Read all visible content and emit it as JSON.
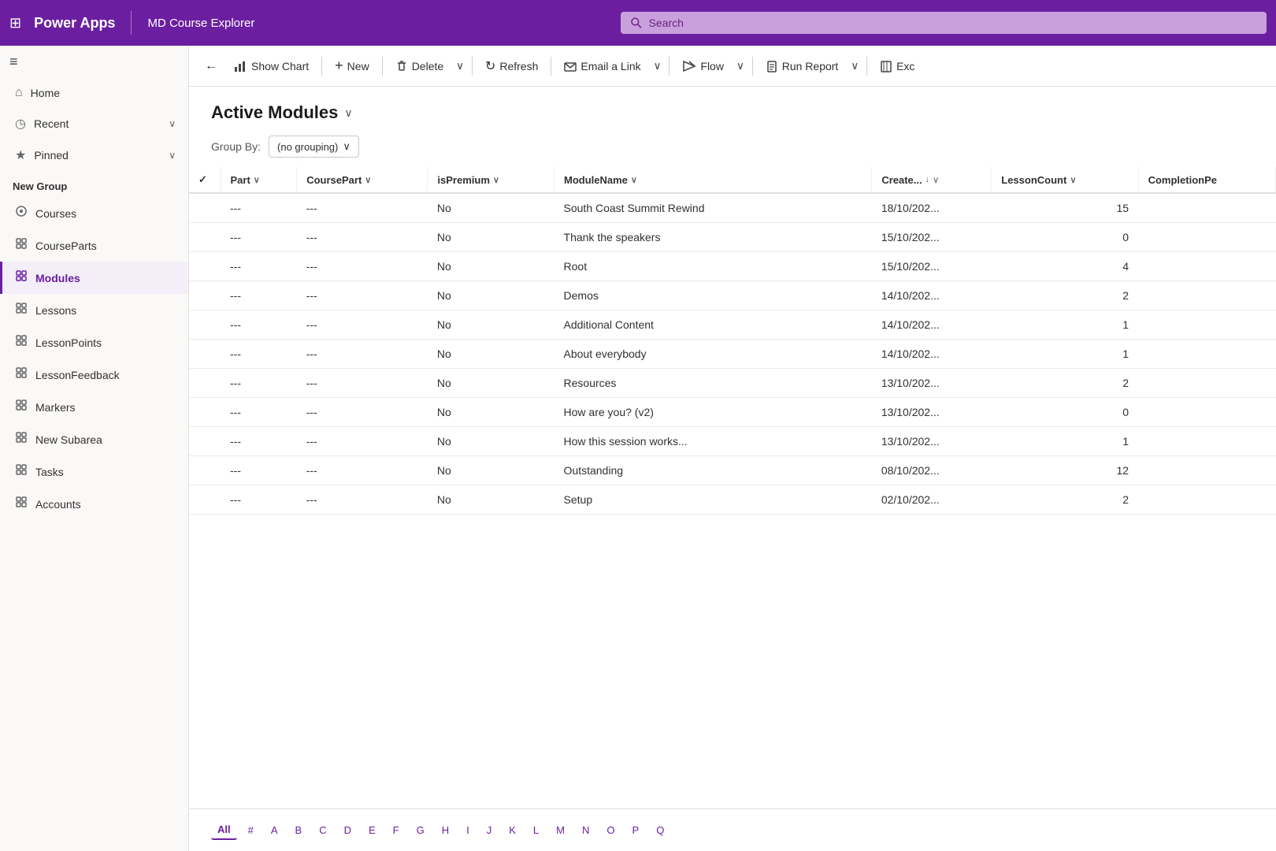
{
  "app": {
    "grid_icon": "⊞",
    "title": "Power Apps",
    "subtitle": "MD Course Explorer"
  },
  "search": {
    "placeholder": "Search"
  },
  "sidebar": {
    "hamburger": "≡",
    "items": [
      {
        "id": "home",
        "icon": "⌂",
        "label": "Home",
        "active": false,
        "hasChevron": false
      },
      {
        "id": "recent",
        "icon": "◷",
        "label": "Recent",
        "active": false,
        "hasChevron": true
      },
      {
        "id": "pinned",
        "icon": "★",
        "label": "Pinned",
        "active": false,
        "hasChevron": true
      }
    ],
    "new_group_label": "New Group",
    "group_items": [
      {
        "id": "courses",
        "icon": "✧",
        "label": "Courses",
        "active": false
      },
      {
        "id": "courseparts",
        "icon": "✦",
        "label": "CourseParts",
        "active": false
      },
      {
        "id": "modules",
        "icon": "✦",
        "label": "Modules",
        "active": true
      },
      {
        "id": "lessons",
        "icon": "✦",
        "label": "Lessons",
        "active": false
      },
      {
        "id": "lessonpoints",
        "icon": "✦",
        "label": "LessonPoints",
        "active": false
      },
      {
        "id": "lessonfeedback",
        "icon": "✦",
        "label": "LessonFeedback",
        "active": false
      },
      {
        "id": "markers",
        "icon": "✦",
        "label": "Markers",
        "active": false
      },
      {
        "id": "newsubarea",
        "icon": "⊞",
        "label": "New Subarea",
        "active": false
      },
      {
        "id": "tasks",
        "icon": "✦",
        "label": "Tasks",
        "active": false
      },
      {
        "id": "accounts",
        "icon": "✦",
        "label": "Accounts",
        "active": false
      }
    ]
  },
  "toolbar": {
    "back_icon": "←",
    "show_chart_icon": "📊",
    "show_chart_label": "Show Chart",
    "new_icon": "+",
    "new_label": "New",
    "delete_icon": "🗑",
    "delete_label": "Delete",
    "refresh_icon": "↻",
    "refresh_label": "Refresh",
    "email_icon": "✉",
    "email_label": "Email a Link",
    "flow_icon": "⚡",
    "flow_label": "Flow",
    "run_report_icon": "📋",
    "run_report_label": "Run Report",
    "excel_icon": "📄",
    "excel_label": "Exc"
  },
  "page": {
    "title": "Active Modules",
    "title_chevron": "∨",
    "group_by_label": "Group By:",
    "group_by_value": "(no grouping)"
  },
  "table": {
    "columns": [
      {
        "id": "check",
        "label": "✓",
        "sortable": false
      },
      {
        "id": "part",
        "label": "Part",
        "sortable": true,
        "filterable": true
      },
      {
        "id": "coursepart",
        "label": "CoursePart",
        "sortable": true,
        "filterable": true
      },
      {
        "id": "ispremium",
        "label": "isPremium",
        "sortable": true,
        "filterable": true
      },
      {
        "id": "modulename",
        "label": "ModuleName",
        "sortable": true,
        "filterable": true
      },
      {
        "id": "created",
        "label": "Create...",
        "sortable": true,
        "filterable": true,
        "sorted": "desc"
      },
      {
        "id": "lessoncount",
        "label": "LessonCount",
        "sortable": true,
        "filterable": true
      },
      {
        "id": "completionpe",
        "label": "CompletionPe",
        "sortable": true,
        "filterable": true
      }
    ],
    "rows": [
      {
        "part": "---",
        "coursepart": "---",
        "ispremium": "No",
        "modulename": "South Coast Summit Rewind",
        "created": "18/10/202...",
        "lessoncount": "15",
        "completionpe": ""
      },
      {
        "part": "---",
        "coursepart": "---",
        "ispremium": "No",
        "modulename": "Thank the speakers",
        "created": "15/10/202...",
        "lessoncount": "0",
        "completionpe": ""
      },
      {
        "part": "---",
        "coursepart": "---",
        "ispremium": "No",
        "modulename": "Root",
        "created": "15/10/202...",
        "lessoncount": "4",
        "completionpe": ""
      },
      {
        "part": "---",
        "coursepart": "---",
        "ispremium": "No",
        "modulename": "Demos",
        "created": "14/10/202...",
        "lessoncount": "2",
        "completionpe": ""
      },
      {
        "part": "---",
        "coursepart": "---",
        "ispremium": "No",
        "modulename": "Additional Content",
        "created": "14/10/202...",
        "lessoncount": "1",
        "completionpe": ""
      },
      {
        "part": "---",
        "coursepart": "---",
        "ispremium": "No",
        "modulename": "About everybody",
        "created": "14/10/202...",
        "lessoncount": "1",
        "completionpe": ""
      },
      {
        "part": "---",
        "coursepart": "---",
        "ispremium": "No",
        "modulename": "Resources",
        "created": "13/10/202...",
        "lessoncount": "2",
        "completionpe": ""
      },
      {
        "part": "---",
        "coursepart": "---",
        "ispremium": "No",
        "modulename": "How are you? (v2)",
        "created": "13/10/202...",
        "lessoncount": "0",
        "completionpe": ""
      },
      {
        "part": "---",
        "coursepart": "---",
        "ispremium": "No",
        "modulename": "How this session works...",
        "created": "13/10/202...",
        "lessoncount": "1",
        "completionpe": ""
      },
      {
        "part": "---",
        "coursepart": "---",
        "ispremium": "No",
        "modulename": "Outstanding",
        "created": "08/10/202...",
        "lessoncount": "12",
        "completionpe": ""
      },
      {
        "part": "---",
        "coursepart": "---",
        "ispremium": "No",
        "modulename": "Setup",
        "created": "02/10/202...",
        "lessoncount": "2",
        "completionpe": ""
      }
    ]
  },
  "pagination": {
    "items": [
      "All",
      "#",
      "A",
      "B",
      "C",
      "D",
      "E",
      "F",
      "G",
      "H",
      "I",
      "J",
      "K",
      "L",
      "M",
      "N",
      "O",
      "P",
      "Q"
    ],
    "active": "All"
  }
}
